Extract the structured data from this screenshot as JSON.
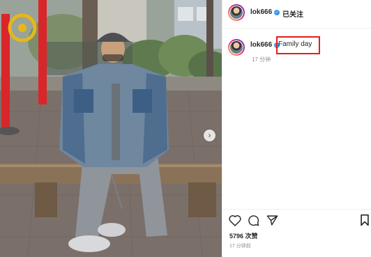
{
  "post": {
    "username": "lok666",
    "follow_status": "已关注",
    "caption": "Family day",
    "caption_time": "17 分钟",
    "likes": "5796 次赞",
    "post_time": "17 分钟前"
  },
  "icons": {
    "verified": "verified-badge-icon",
    "next": "chevron-right-icon",
    "like": "heart-icon",
    "comment": "comment-icon",
    "share": "paper-plane-icon",
    "save": "bookmark-icon"
  },
  "colors": {
    "highlight_box": "#e0201c",
    "verified": "#3897f0",
    "meta_text": "#8e8e8e"
  }
}
